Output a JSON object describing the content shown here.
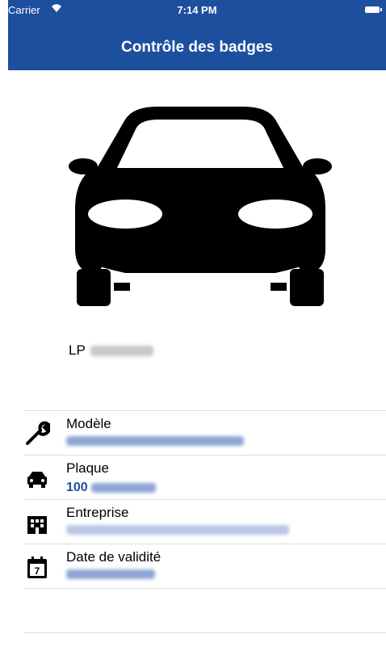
{
  "status_bar": {
    "carrier": "Carrier",
    "time": "7:14 PM"
  },
  "header": {
    "title": "Contrôle des badges"
  },
  "vehicle": {
    "plate_prefix": "LP"
  },
  "fields": [
    {
      "label": "Modèle",
      "value": "",
      "icon": "wrench-icon"
    },
    {
      "label": "Plaque",
      "value": "100",
      "icon": "car-icon"
    },
    {
      "label": "Entreprise",
      "value": "",
      "icon": "building-icon"
    },
    {
      "label": "Date de validité",
      "value": "",
      "icon": "calendar-icon"
    }
  ],
  "colors": {
    "header_bg": "#1d4f9f",
    "value_text": "#1d4f9f",
    "blur_mask": "#8fa6d6"
  }
}
